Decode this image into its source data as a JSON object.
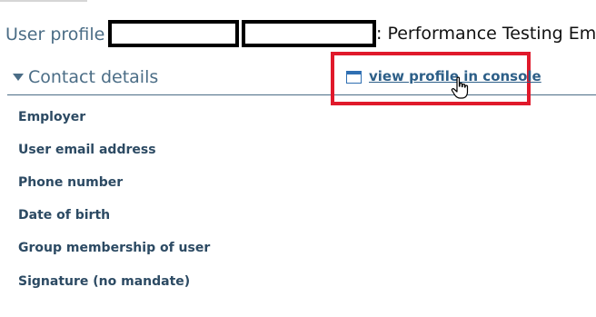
{
  "header": {
    "title_prefix": "User profile",
    "title_suffix": ": Performance Testing Emp"
  },
  "contact_section": {
    "title": "Contact details",
    "collapse_icon": "triangle-down-icon",
    "console_link": {
      "icon": "window-icon",
      "label": "view profile in console"
    },
    "fields": [
      {
        "label": "Employer"
      },
      {
        "label": "User email address"
      },
      {
        "label": "Phone number"
      },
      {
        "label": "Date of birth"
      },
      {
        "label": "Group membership of user"
      },
      {
        "label": "Signature (no mandate)"
      }
    ]
  },
  "colors": {
    "heading": "#4b6d86",
    "field_label": "#2c4a63",
    "link": "#2d5f88",
    "highlight": "#e0192b",
    "redaction": "#000000"
  }
}
